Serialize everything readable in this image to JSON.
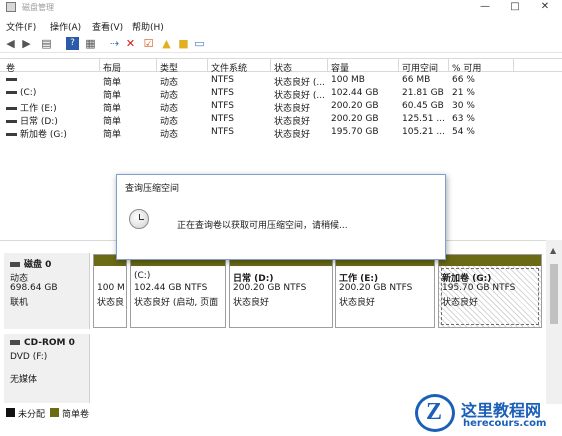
{
  "window": {
    "title": "磁盘管理",
    "controls": [
      "—",
      "□",
      "✕"
    ]
  },
  "menu": [
    "文件(F)",
    "操作(A)",
    "查看(V)",
    "帮助(H)"
  ],
  "toolbar": [
    "back-icon",
    "forward-icon",
    "list-view-icon",
    "help-icon",
    "properties-icon",
    "rescan-icon",
    "delete-icon",
    "checkmark-icon",
    "folder-up-icon",
    "folder-search-icon",
    "console-icon"
  ],
  "table": {
    "headers": [
      "卷",
      "布局",
      "类型",
      "文件系统",
      "状态",
      "容量",
      "可用空间",
      "% 可用"
    ],
    "rows": [
      [
        "",
        "简单",
        "动态",
        "NTFS",
        "状态良好 (...",
        "100 MB",
        "66 MB",
        "66 %"
      ],
      [
        "(C:)",
        "简单",
        "动态",
        "NTFS",
        "状态良好 (...",
        "102.44 GB",
        "21.81 GB",
        "21 %"
      ],
      [
        "工作 (E:)",
        "简单",
        "动态",
        "NTFS",
        "状态良好",
        "200.20 GB",
        "60.45 GB",
        "30 %"
      ],
      [
        "日常 (D:)",
        "简单",
        "动态",
        "NTFS",
        "状态良好",
        "200.20 GB",
        "125.51 ...",
        "63 %"
      ],
      [
        "新加卷 (G:)",
        "简单",
        "动态",
        "NTFS",
        "状态良好",
        "195.70 GB",
        "105.21 ...",
        "54 %"
      ]
    ]
  },
  "dialog": {
    "title": "查询压缩空间",
    "message": "正在查询卷以获取可用压缩空间，请稍候..."
  },
  "disk0": {
    "name": "磁盘 0",
    "type": "动态",
    "size": "698.64 GB",
    "status": "联机",
    "partitions": [
      {
        "label": "",
        "line2": "100 M",
        "line3": "状态良"
      },
      {
        "label": "(C:)",
        "line2": "102.44 GB NTFS",
        "line3": "状态良好 (启动, 页面"
      },
      {
        "label": "日常  (D:)",
        "line2": "200.20 GB NTFS",
        "line3": "状态良好"
      },
      {
        "label": "工作  (E:)",
        "line2": "200.20 GB NTFS",
        "line3": "状态良好"
      },
      {
        "label": "新加卷  (G:)",
        "line2": "195.70 GB NTFS",
        "line3": "状态良好"
      }
    ]
  },
  "cdrom": {
    "name": "CD-ROM 0",
    "drive": "DVD (F:)",
    "media": "无媒体"
  },
  "legend": [
    {
      "label": "未分配",
      "color": "#111111"
    },
    {
      "label": "简单卷",
      "color": "#6b6b16"
    }
  ],
  "watermark": {
    "logo_letter": "Z",
    "title": "这里教程网",
    "url": "herecours.com"
  },
  "colors": {
    "volume_cap": "#6b6b16",
    "dialog_border": "#7f9fcf",
    "watermark": "#1a5fb8"
  }
}
